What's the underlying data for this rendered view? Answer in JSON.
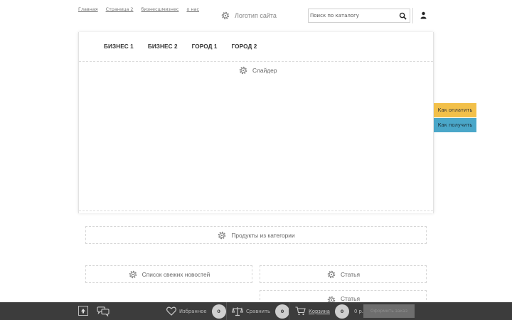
{
  "top_links": [
    "Главная",
    "Страница 2",
    "бизнесшмизнес",
    "о нас"
  ],
  "logo": {
    "label": "Логотип сайта",
    "icon": "gear-icon"
  },
  "search": {
    "placeholder": "Поиск по каталогу",
    "icon": "search-icon"
  },
  "user": {
    "icon": "user-icon"
  },
  "nav": [
    "БИЗНЕС 1",
    "БИЗНЕС 2",
    "ГОРОД 1",
    "ГОРОД 2"
  ],
  "slider": {
    "label": "Слайдер"
  },
  "blocks": {
    "products": "Продукты из категории",
    "news": "Список свежих новостей",
    "article1": "Статья",
    "article2": "Статья"
  },
  "side_buttons": {
    "pay": "Как оплатить",
    "get": "Как получить"
  },
  "bottom_bar": {
    "favorites_label": "Избранное",
    "favorites_count": "0",
    "compare_label": "Сравнить",
    "compare_count": "0",
    "cart_label": "Корзина",
    "cart_count": "0",
    "cart_sum": "0 р.",
    "order_button": "Оформить заказ"
  },
  "colors": {
    "pay": "#f2c04a",
    "get": "#4aa7c9",
    "bar": "#3c3c3c"
  }
}
